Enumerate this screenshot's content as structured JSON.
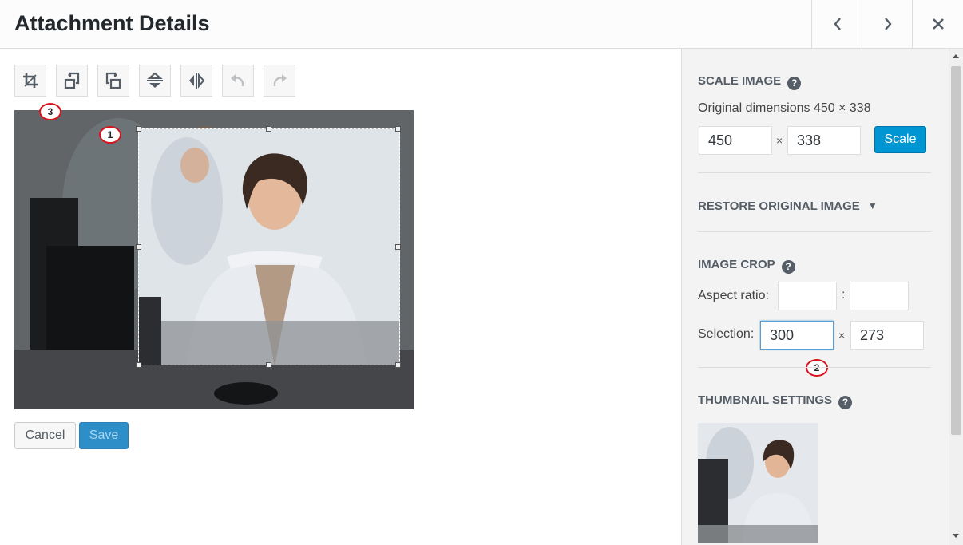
{
  "header": {
    "title": "Attachment Details",
    "prev_icon": "chevron-left-icon",
    "next_icon": "chevron-right-icon",
    "close_icon": "close-icon"
  },
  "toolbar": {
    "tools": [
      {
        "icon": "crop-icon",
        "enabled": true
      },
      {
        "icon": "rotate-left-icon",
        "enabled": true
      },
      {
        "icon": "rotate-right-icon",
        "enabled": true
      },
      {
        "icon": "flip-vertical-icon",
        "enabled": true
      },
      {
        "icon": "flip-horizontal-icon",
        "enabled": true
      },
      {
        "icon": "undo-icon",
        "enabled": false
      },
      {
        "icon": "redo-icon",
        "enabled": false
      }
    ]
  },
  "annotations": {
    "one": "1",
    "two": "2",
    "three": "3",
    "color": "#d9121b"
  },
  "actions": {
    "cancel_label": "Cancel",
    "save_label": "Save"
  },
  "sidebar": {
    "scale": {
      "title": "SCALE IMAGE",
      "original": "Original dimensions 450 × 338",
      "width": "450",
      "height": "338",
      "times": "×",
      "button": "Scale"
    },
    "restore": {
      "title": "RESTORE ORIGINAL IMAGE",
      "arrow": "▼"
    },
    "crop": {
      "title": "IMAGE CROP",
      "aspect_label": "Aspect ratio:",
      "aspect_w": "",
      "aspect_h": "",
      "colon": ":",
      "selection_label": "Selection:",
      "selection_w": "300",
      "selection_h": "273",
      "times": "×"
    },
    "thumbnail": {
      "title": "THUMBNAIL SETTINGS"
    },
    "help_glyph": "?"
  },
  "colors": {
    "accent": "#0095d3",
    "save_disabled": "#2e8fc8",
    "sidebar_bg": "#f3f3f3"
  }
}
